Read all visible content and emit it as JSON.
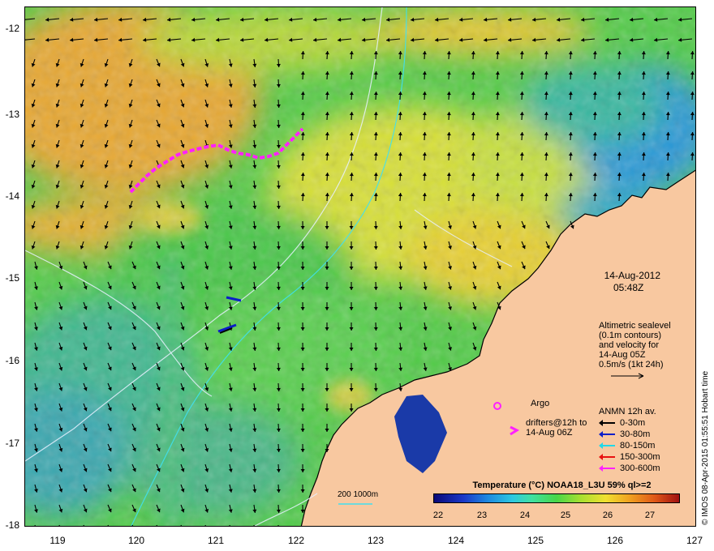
{
  "map": {
    "date": "14-Aug-2012",
    "time": "05:48Z",
    "altimetry_text": [
      "Altimetric sealevel",
      "(0.1m contours)",
      "and velocity for",
      "14-Aug 05Z",
      "0.5m/s (1kt 24h)"
    ],
    "argo_label": "Argo",
    "drifters_label": [
      "drifters@12h to",
      "14-Aug 06Z"
    ],
    "anmn_title": "ANMN 12h av.",
    "anmn_legend": [
      {
        "label": "0-30m",
        "color": "#000000"
      },
      {
        "label": "30-80m",
        "color": "#0a1ec8"
      },
      {
        "label": "80-150m",
        "color": "#20d8e8"
      },
      {
        "label": "150-300m",
        "color": "#e81010"
      },
      {
        "label": "300-600m",
        "color": "#ff20ff"
      }
    ],
    "depth_label": "200  1000m",
    "colorbar_title": "Temperature (°C) NOAA18_L3U 59% ql>=2",
    "colorbar_ticks": [
      "22",
      "23",
      "24",
      "25",
      "26",
      "27"
    ],
    "lat_ticks": [
      "-12",
      "-13",
      "-14",
      "-15",
      "-16",
      "-17",
      "-18"
    ],
    "lon_ticks": [
      "119",
      "120",
      "121",
      "122",
      "123",
      "124",
      "125",
      "126",
      "127"
    ],
    "credit": "© IMOS 08-Apr-2015 01:55:51 Hobart time"
  },
  "colors": {
    "land": "#f8c8a0",
    "drifter": "#ff20ff",
    "contour": "#e8f0ff",
    "isobath": "#40e0f0"
  }
}
